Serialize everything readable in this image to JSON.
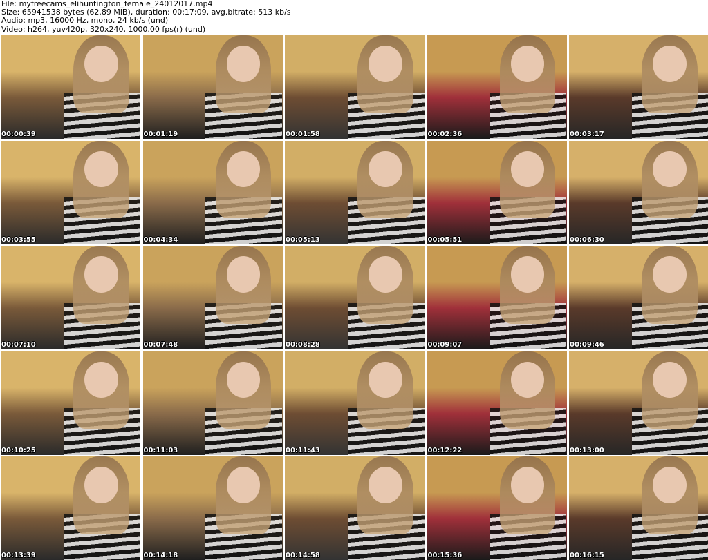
{
  "header": {
    "file_line": "File: myfreecams_elihuntington_female_24012017.mp4",
    "size_line": "Size: 65941538 bytes (62.89 MiB), duration: 00:17:09, avg.bitrate: 513 kb/s",
    "audio_line": "Audio: mp3, 16000 Hz, mono, 24 kb/s (und)",
    "video_line": "Video: h264, yuv420p, 320x240, 1000.00 fps(r) (und)"
  },
  "thumbnails": [
    {
      "timestamp": "00:00:39"
    },
    {
      "timestamp": "00:01:19"
    },
    {
      "timestamp": "00:01:58"
    },
    {
      "timestamp": "00:02:36"
    },
    {
      "timestamp": "00:03:17"
    },
    {
      "timestamp": "00:03:55"
    },
    {
      "timestamp": "00:04:34"
    },
    {
      "timestamp": "00:05:13"
    },
    {
      "timestamp": "00:05:51"
    },
    {
      "timestamp": "00:06:30"
    },
    {
      "timestamp": "00:07:10"
    },
    {
      "timestamp": "00:07:48"
    },
    {
      "timestamp": "00:08:28"
    },
    {
      "timestamp": "00:09:07"
    },
    {
      "timestamp": "00:09:46"
    },
    {
      "timestamp": "00:10:25"
    },
    {
      "timestamp": "00:11:03"
    },
    {
      "timestamp": "00:11:43"
    },
    {
      "timestamp": "00:12:22"
    },
    {
      "timestamp": "00:13:00"
    },
    {
      "timestamp": "00:13:39"
    },
    {
      "timestamp": "00:14:18"
    },
    {
      "timestamp": "00:14:58"
    },
    {
      "timestamp": "00:15:36"
    },
    {
      "timestamp": "00:16:15"
    }
  ]
}
